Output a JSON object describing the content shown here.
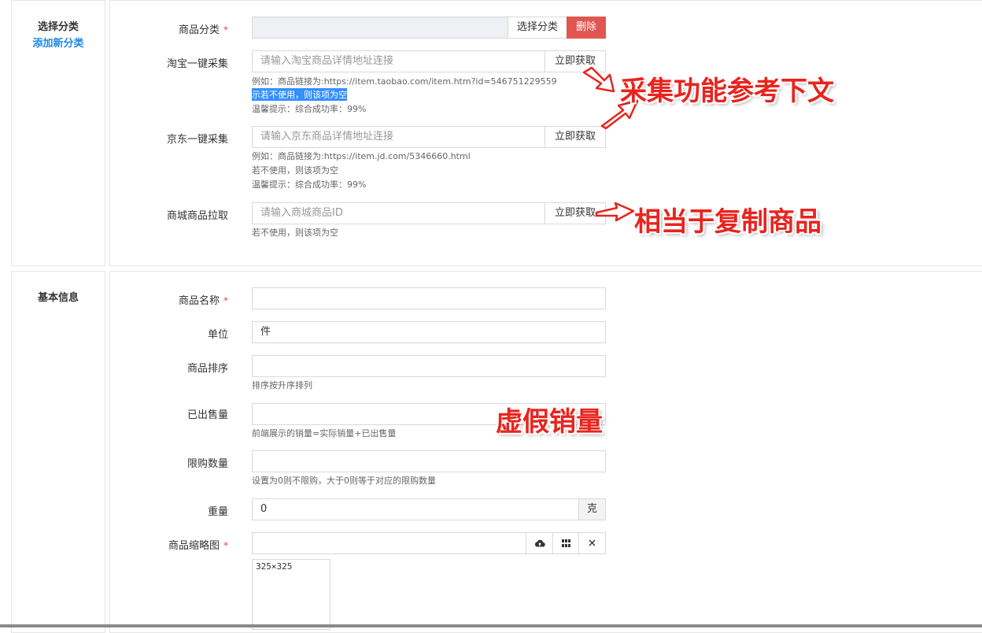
{
  "section1": {
    "title": "选择分类",
    "add_link": "添加新分类"
  },
  "category": {
    "label": "商品分类",
    "required_mark": "*",
    "value": "",
    "select_button": "选择分类",
    "delete_button": "删除"
  },
  "taobao": {
    "label": "淘宝一键采集",
    "placeholder": "请输入淘宝商品详情地址连接",
    "fetch_button": "立即获取",
    "help_example": "例如：商品链接为:https://item.taobao.com/item.htm?id=546751229559",
    "help_unused": "示若不使用，则该项为空",
    "help_tip": "温馨提示：综合成功率：99%"
  },
  "jd": {
    "label": "京东一键采集",
    "placeholder": "请输入京东商品详情地址连接",
    "fetch_button": "立即获取",
    "help_example": "例如：商品链接为:https://item.jd.com/5346660.html",
    "help_unused": "若不使用，则该项为空",
    "help_tip": "温馨提示：综合成功率：99%"
  },
  "mall": {
    "label": "商城商品拉取",
    "placeholder": "请输入商城商品ID",
    "fetch_button": "立即获取",
    "help_unused": "若不使用，则该项为空"
  },
  "section2": {
    "title": "基本信息"
  },
  "name": {
    "label": "商品名称",
    "required_mark": "*",
    "value": ""
  },
  "unit": {
    "label": "单位",
    "value": "件"
  },
  "sort": {
    "label": "商品排序",
    "value": "",
    "help": "排序按升序排列"
  },
  "sold": {
    "label": "已出售量",
    "value": "",
    "help": "前端展示的销量=实际销量+已出售量"
  },
  "limit": {
    "label": "限购数量",
    "value": "",
    "help": "设置为0则不限购，大于0则等于对应的限购数量"
  },
  "weight": {
    "label": "重量",
    "value": "0",
    "unit": "克"
  },
  "thumb": {
    "label": "商品缩略图",
    "required_mark": "*",
    "value": "",
    "size_hint": "325×325"
  },
  "annotations": {
    "collect": "采集功能参考下文",
    "copy": "相当于复制商品",
    "fake_sales": "虚假销量",
    "color": "#e8241e"
  }
}
